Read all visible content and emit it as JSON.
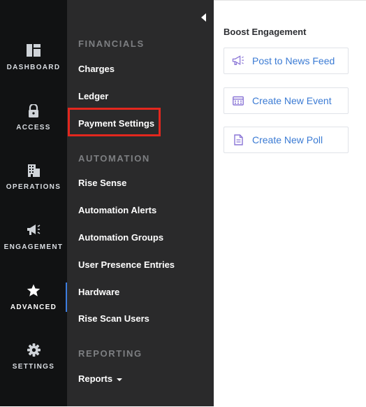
{
  "rail": {
    "items": [
      {
        "label": "DASHBOARD",
        "icon": "dashboard-icon"
      },
      {
        "label": "ACCESS",
        "icon": "lock-icon"
      },
      {
        "label": "OPERATIONS",
        "icon": "building-icon"
      },
      {
        "label": "ENGAGEMENT",
        "icon": "megaphone-icon"
      },
      {
        "label": "ADVANCED",
        "icon": "star-icon",
        "active": true
      },
      {
        "label": "SETTINGS",
        "icon": "gear-icon"
      }
    ],
    "active_accent": "#3c7de0"
  },
  "panel": {
    "sections": [
      {
        "title": "FINANCIALS",
        "links": [
          "Charges",
          "Ledger",
          "Payment Settings"
        ]
      },
      {
        "title": "AUTOMATION",
        "links": [
          "Rise Sense",
          "Automation Alerts",
          "Automation Groups",
          "User Presence Entries",
          "Hardware",
          "Rise Scan Users"
        ]
      },
      {
        "title": "REPORTING",
        "links": [
          "Reports"
        ]
      }
    ],
    "highlighted": "Payment Settings",
    "highlight_color": "#e3271e"
  },
  "content": {
    "title": "Boost Engagement",
    "buttons": [
      {
        "label": "Post to News Feed",
        "icon": "megaphone-icon"
      },
      {
        "label": "Create New Event",
        "icon": "calendar-icon"
      },
      {
        "label": "Create New Poll",
        "icon": "document-icon"
      }
    ],
    "accent": "#3b7bd4"
  }
}
